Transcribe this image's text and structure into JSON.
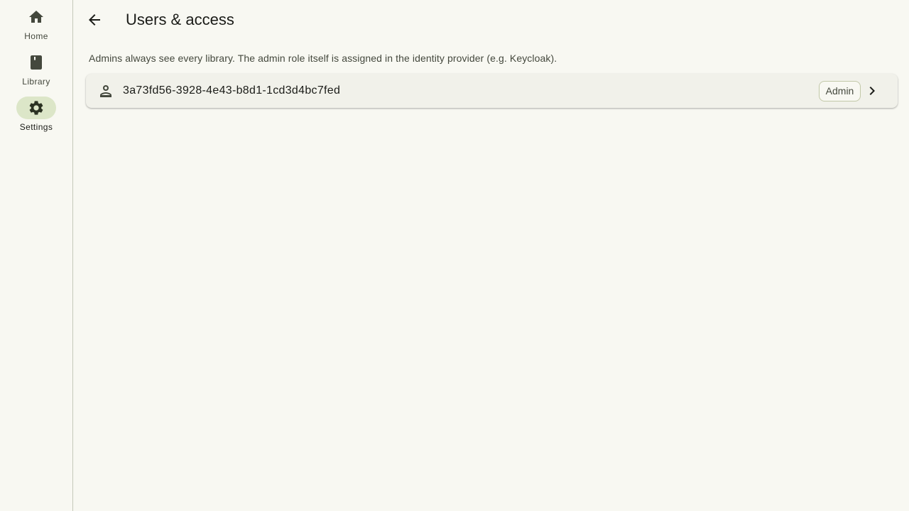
{
  "nav": {
    "items": [
      {
        "label": "Home",
        "icon": "home-icon",
        "active": false
      },
      {
        "label": "Library",
        "icon": "book-icon",
        "active": false
      },
      {
        "label": "Settings",
        "icon": "gear-icon",
        "active": true
      }
    ]
  },
  "header": {
    "title": "Users & access"
  },
  "hint": "Admins always see every library. The admin role itself is assigned in the identity provider (e.g. Keycloak).",
  "users": [
    {
      "id": "3a73fd56-3928-4e43-b8d1-1cd3d4bc7fed",
      "role": "Admin"
    }
  ],
  "colors": {
    "background": "#f8f8f2",
    "active_pill": "#dce6c8",
    "row_background": "#f1f1ea"
  }
}
